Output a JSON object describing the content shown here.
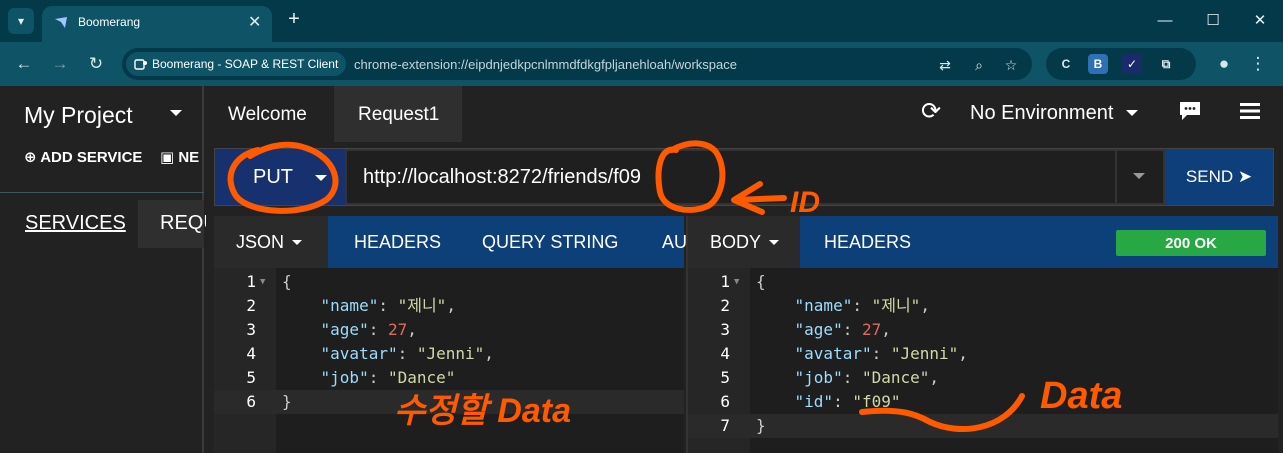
{
  "browser": {
    "tab_title": "Boomerang",
    "site_chip": "Boomerang - SOAP & REST Client",
    "url": "chrome-extension://eipdnjedkpcnlmmdfdkgfpljanehloah/workspace"
  },
  "sidebar": {
    "project": "My Project",
    "add_service": "ADD SERVICE",
    "new_item": "NE",
    "tab_services": "SERVICES",
    "tab_requests": "REQU"
  },
  "main": {
    "tabs": [
      "Welcome",
      "Request1"
    ],
    "environment": "No Environment"
  },
  "request": {
    "method": "PUT",
    "url": "http://localhost:8272/friends/f09",
    "send": "SEND ➤",
    "tabs": [
      "JSON",
      "HEADERS",
      "QUERY STRING",
      "AU"
    ],
    "body": [
      {
        "n": "1",
        "t": "{"
      },
      {
        "n": "2",
        "t": "    \"name\": \"제니\","
      },
      {
        "n": "3",
        "t": "    \"age\": 27,"
      },
      {
        "n": "4",
        "t": "    \"avatar\": \"Jenni\","
      },
      {
        "n": "5",
        "t": "    \"job\": \"Dance\""
      },
      {
        "n": "6",
        "t": "}"
      }
    ]
  },
  "response": {
    "tabs": [
      "BODY",
      "HEADERS"
    ],
    "status": "200 OK",
    "body": [
      {
        "n": "1",
        "t": "{"
      },
      {
        "n": "2",
        "t": "    \"name\": \"제니\","
      },
      {
        "n": "3",
        "t": "    \"age\": 27,"
      },
      {
        "n": "4",
        "t": "    \"avatar\": \"Jenni\","
      },
      {
        "n": "5",
        "t": "    \"job\": \"Dance\","
      },
      {
        "n": "6",
        "t": "    \"id\": \"f09\""
      },
      {
        "n": "7",
        "t": "}"
      }
    ]
  },
  "annotations": {
    "id_note": "ID",
    "request_note": "수정할 Data",
    "response_note": "Data",
    "color": "#ff5a00"
  }
}
